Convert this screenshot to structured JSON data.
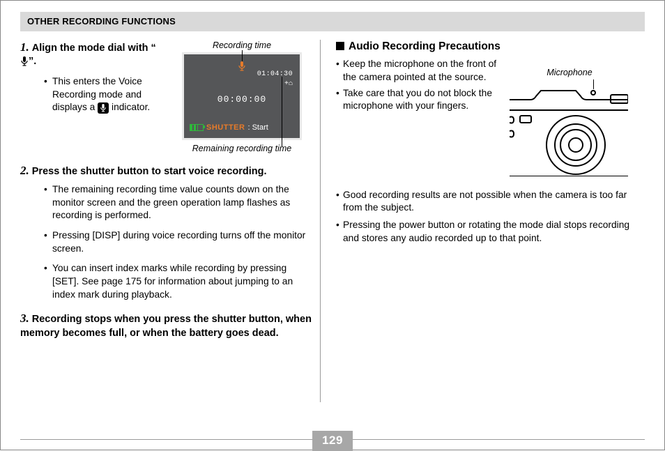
{
  "header": "OTHER RECORDING FUNCTIONS",
  "page_number": "129",
  "left": {
    "step1": {
      "num": "1.",
      "head_pre": "Align the mode dial with “",
      "head_post": "”.",
      "bullets": [
        {
          "pre": "This enters the Voice Recording mode and displays a ",
          "post": " indicator."
        }
      ]
    },
    "fig1": {
      "caption_top": "Recording time",
      "caption_bottom": "Remaining recording time",
      "screen": {
        "remain": "01:04:30",
        "elapsed": "00:00:00",
        "shutter_label": "SHUTTER",
        "start_label": ": Start"
      }
    },
    "step2": {
      "num": "2.",
      "head": "Press the shutter button to start voice recording.",
      "bullets": [
        "The remaining recording time value counts down on the monitor screen and the green operation lamp flashes as recording is performed.",
        "Pressing [DISP] during voice recording turns off the monitor screen.",
        "You can insert index marks while recording by pressing [SET]. See page 175 for information about jumping to an index mark during playback."
      ]
    },
    "step3": {
      "num": "3.",
      "head": "Recording stops when you press the shutter button, when memory becomes full, or when the battery goes dead."
    }
  },
  "right": {
    "heading": "Audio Recording Precautions",
    "top_bullets": [
      "Keep the microphone on the front of the camera pointed at the source.",
      "Take care that you do not block the microphone with your fingers."
    ],
    "fig2_caption": "Microphone",
    "bottom_bullets": [
      "Good recording results are not possible when the camera is too far from the subject.",
      "Pressing the power button or rotating the mode dial stops recording and stores any audio recorded up to that point."
    ]
  }
}
